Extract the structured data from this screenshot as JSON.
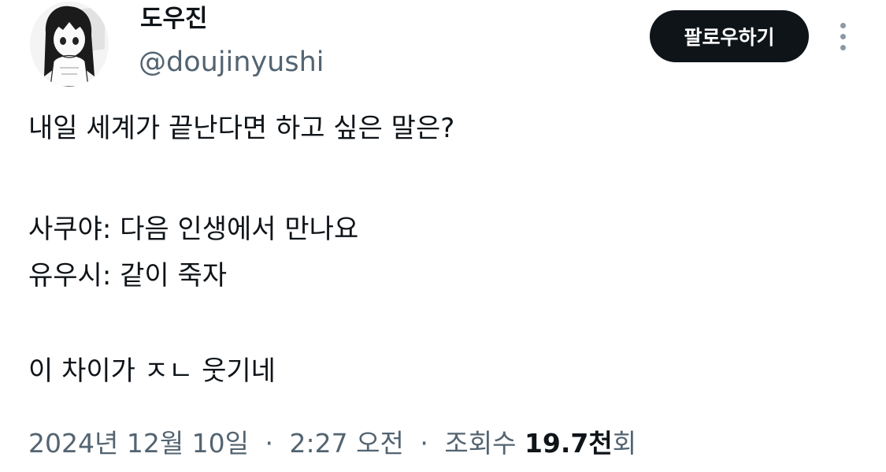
{
  "user": {
    "display_name": "도우진",
    "handle": "@doujinyushi"
  },
  "follow_button": {
    "label": "팔로우하기"
  },
  "more_icon": "more-vertical-icon",
  "tweet": {
    "lines": [
      "내일 세계가 끝난다면 하고 싶은 말은?",
      "",
      "사쿠야: 다음 인생에서 만나요",
      "유우시: 같이 죽자",
      "",
      "이 차이가 ㅈㄴ 웃기네"
    ]
  },
  "meta": {
    "date": "2024년 12월 10일",
    "separator": "·",
    "time": "2:27 오전",
    "views_label": "조회수",
    "views_count": "19.7천",
    "views_suffix": "회"
  },
  "colors": {
    "text_primary": "#0f1419",
    "text_secondary": "#536471",
    "button_bg": "#0f1419",
    "button_text": "#ffffff"
  }
}
